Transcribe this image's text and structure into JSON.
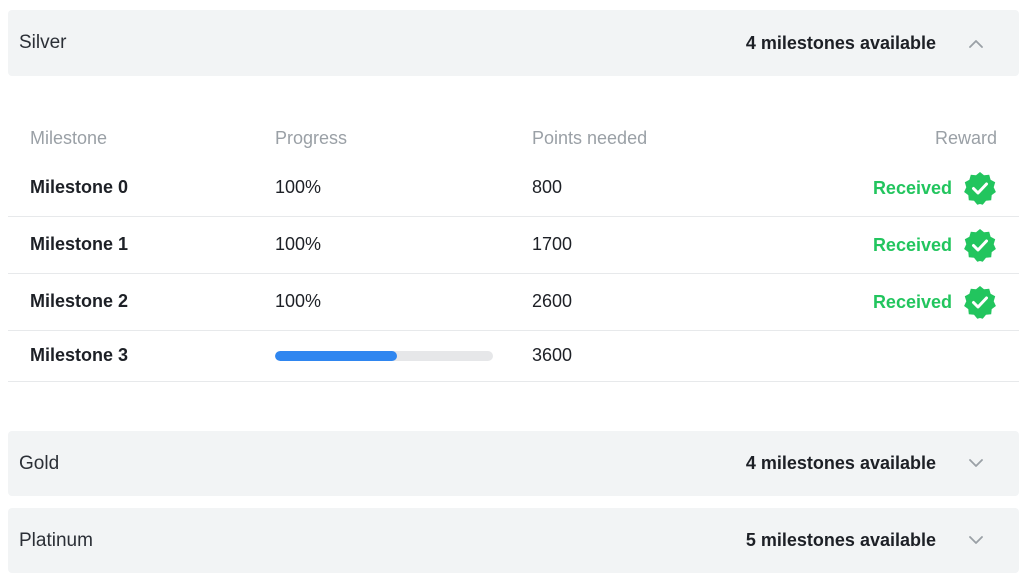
{
  "sections": [
    {
      "title": "Silver",
      "count_label": "4 milestones available",
      "expanded": true,
      "chevron_icon": "chevron-up-icon"
    },
    {
      "title": "Gold",
      "count_label": "4 milestones available",
      "expanded": false,
      "chevron_icon": "chevron-down-icon"
    },
    {
      "title": "Platinum",
      "count_label": "5 milestones available",
      "expanded": false,
      "chevron_icon": "chevron-down-icon"
    }
  ],
  "table": {
    "headers": {
      "milestone": "Milestone",
      "progress": "Progress",
      "points": "Points needed",
      "reward": "Reward"
    },
    "rows": [
      {
        "name": "Milestone 0",
        "progress_text": "100%",
        "points": "800",
        "reward": "Received",
        "reward_icon": "check-badge-icon"
      },
      {
        "name": "Milestone 1",
        "progress_text": "100%",
        "points": "1700",
        "reward": "Received",
        "reward_icon": "check-badge-icon"
      },
      {
        "name": "Milestone 2",
        "progress_text": "100%",
        "points": "2600",
        "reward": "Received",
        "reward_icon": "check-badge-icon"
      },
      {
        "name": "Milestone 3",
        "progress_fraction": 0.56,
        "points": "3600"
      }
    ]
  },
  "colors": {
    "panel_bg": "#f2f4f5",
    "received": "#22c55e",
    "progress_fill": "#2f86f0",
    "progress_track": "#e6e7e9"
  }
}
